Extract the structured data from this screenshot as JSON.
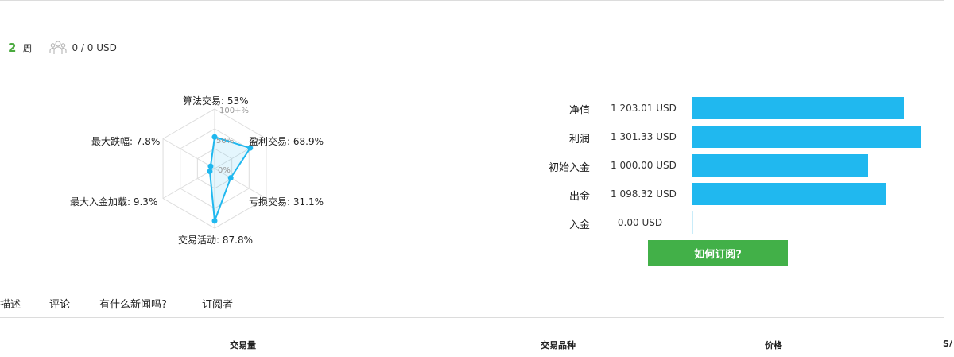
{
  "stats": {
    "weeks_value": "2",
    "weeks_unit": "周",
    "subscribers_icon": "people-icon",
    "subscribers_funds": "0 / 0 USD"
  },
  "radar": {
    "axes": [
      {
        "name": "算法交易",
        "value": 53,
        "label": "算法交易: 53%"
      },
      {
        "name": "盈利交易",
        "value": 68.9,
        "label": "盈利交易: 68.9%"
      },
      {
        "name": "亏损交易",
        "value": 31.1,
        "label": "亏损交易: 31.1%"
      },
      {
        "name": "交易活动",
        "value": 87.8,
        "label": "交易活动: 87.8%"
      },
      {
        "name": "最大入金加载",
        "value": 9.3,
        "label": "最大入金加载: 9.3%"
      },
      {
        "name": "最大跌幅",
        "value": 7.8,
        "label": "最大跌幅: 7.8%"
      }
    ],
    "ticks": [
      "100+%",
      "50%",
      "0%"
    ],
    "color": "#20b8ef"
  },
  "balance": {
    "rows": [
      {
        "name": "净值",
        "value_text": "1 203.01 USD",
        "value": 1203.01
      },
      {
        "name": "利润",
        "value_text": "1 301.33 USD",
        "value": 1301.33
      },
      {
        "name": "初始入金",
        "value_text": "1 000.00 USD",
        "value": 1000.0
      },
      {
        "name": "出金",
        "value_text": "1 098.32 USD",
        "value": 1098.32
      },
      {
        "name": "入金",
        "value_text": "0.00 USD",
        "value": 0.0
      }
    ],
    "bar_color": "#20b8ef"
  },
  "subscribe_button": {
    "label": "如何订阅?",
    "color": "#42b048"
  },
  "tabs": [
    "描述",
    "评论",
    "有什么新闻吗?",
    "订阅者"
  ],
  "table_headers": [
    "交易量",
    "交易品种",
    "价格",
    "S/"
  ]
}
